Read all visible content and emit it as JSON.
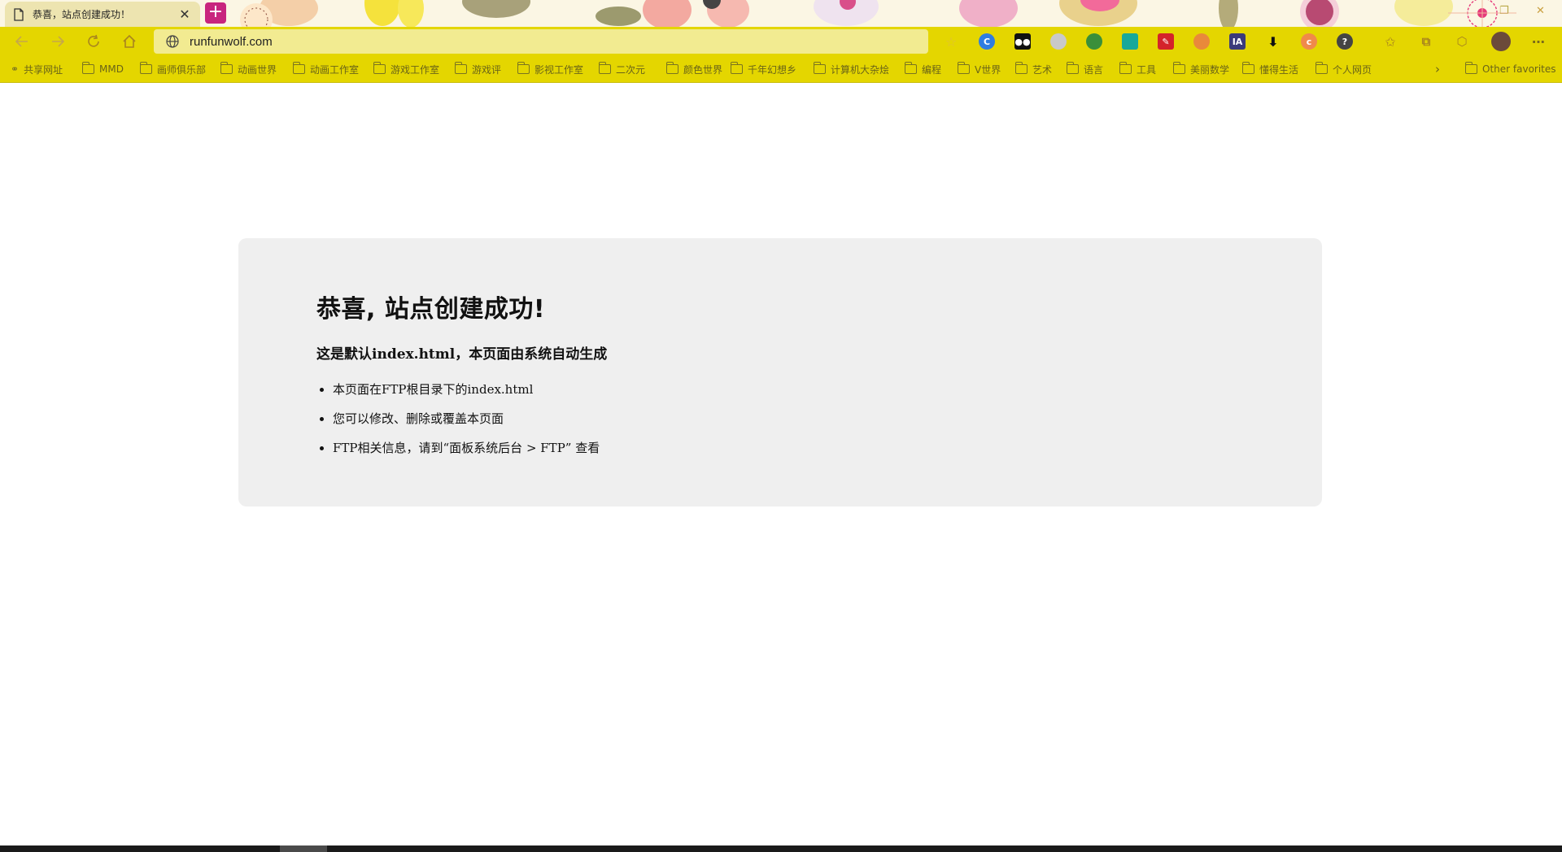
{
  "tab": {
    "title": "恭喜，站点创建成功！",
    "close_glyph": "✕",
    "new_tab_glyph": "+"
  },
  "address_bar": {
    "url": "runfunwolf.com"
  },
  "favorites": {
    "shared": "共享网址",
    "folders": [
      "MMD",
      "画师俱乐部",
      "动画世界",
      "动画工作室",
      "游戏工作室",
      "游戏评",
      "影视工作室",
      "二次元",
      "颜色世界",
      "千年幻想乡",
      "计算机大杂烩",
      "编程",
      "V世界",
      "艺术",
      "语言",
      "工具",
      "美丽数学",
      "懂得生活",
      "个人网页"
    ],
    "more_glyph": "›",
    "other": "Other favorites"
  },
  "extensions": {
    "ia_label": "IA",
    "more_glyph": "⋯"
  },
  "content": {
    "heading": "恭喜, 站点创建成功!",
    "subheading": "这是默认index.html，本页面由系统自动生成",
    "items": [
      "本页面在FTP根目录下的index.html",
      "您可以修改、删除或覆盖本页面",
      "FTP相关信息，请到“面板系统后台 > FTP” 查看"
    ]
  },
  "colors": {
    "toolbar": "#e4d600",
    "address_bar": "#f2eb91",
    "card_bg": "#efefef",
    "new_tab_accent": "#c8257e"
  }
}
